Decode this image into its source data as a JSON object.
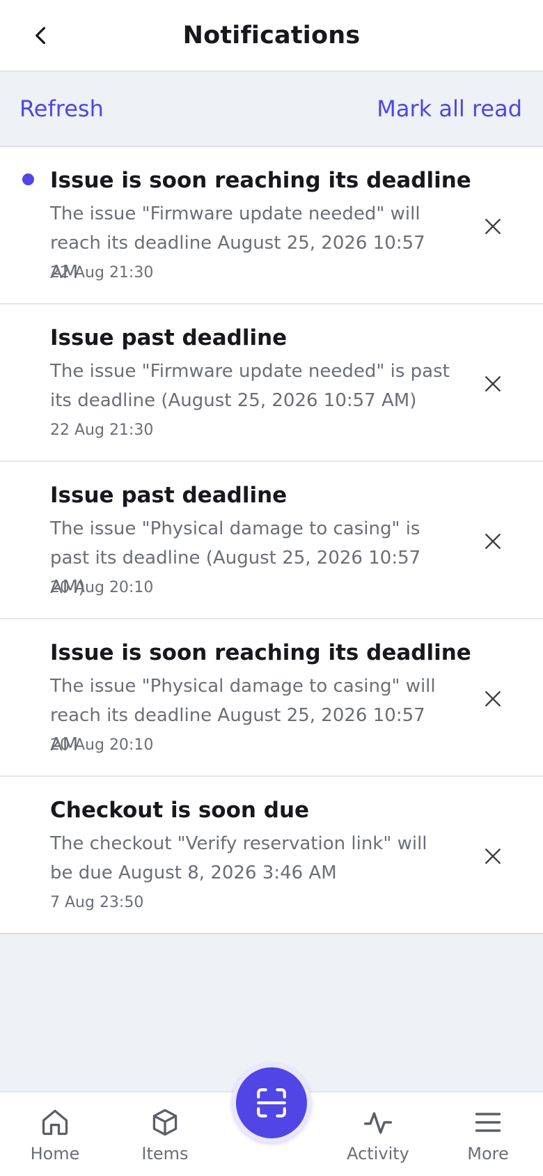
{
  "header": {
    "title": "Notifications",
    "back_icon": "chevron-left-icon"
  },
  "actions": {
    "refresh_label": "Refresh",
    "mark_all_label": "Mark all read"
  },
  "colors": {
    "accent": "#4f46e5",
    "text_primary": "#17171c",
    "text_secondary": "#6b6e76",
    "background": "#eef1f5"
  },
  "notifications": [
    {
      "unread": true,
      "title": "Issue is soon reaching its deadline",
      "body": "The issue \"Firmware update needed\" will reach its deadline August 25, 2026 10:57 AM",
      "time": "22 Aug 21:30"
    },
    {
      "unread": false,
      "title": "Issue past deadline",
      "body": "The issue \"Firmware update needed\" is past its deadline (August 25, 2026 10:57 AM)",
      "time": "22 Aug 21:30"
    },
    {
      "unread": false,
      "title": "Issue past deadline",
      "body": "The issue \"Physical damage to casing\" is past its deadline (August 25, 2026 10:57 AM)",
      "time": "20 Aug 20:10"
    },
    {
      "unread": false,
      "title": "Issue is soon reaching its deadline",
      "body": "The issue \"Physical damage to casing\" will reach its deadline August 25, 2026 10:57 AM",
      "time": "20 Aug 20:10"
    },
    {
      "unread": false,
      "title": "Checkout is soon due",
      "body": "The checkout \"Verify reservation link\" will be due August 8, 2026 3:46 AM",
      "time": "7 Aug 23:50"
    }
  ],
  "bottom_nav": {
    "home_label": "Home",
    "items_label": "Items",
    "activity_label": "Activity",
    "more_label": "More",
    "scan_icon": "scan-icon"
  }
}
